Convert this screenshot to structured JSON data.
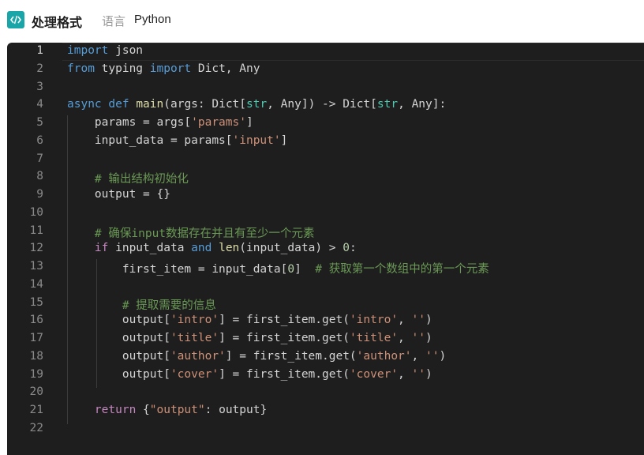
{
  "header": {
    "icon": "code-icon",
    "title": "处理格式",
    "language_label": "语言",
    "language_value": "Python"
  },
  "editor": {
    "current_line": 1,
    "lines": [
      {
        "n": "1",
        "tokens": [
          [
            "kw",
            "import"
          ],
          [
            "p",
            " json"
          ]
        ]
      },
      {
        "n": "2",
        "tokens": [
          [
            "kw",
            "from"
          ],
          [
            "p",
            " typing "
          ],
          [
            "kw",
            "import"
          ],
          [
            "p",
            " Dict, Any"
          ]
        ]
      },
      {
        "n": "3",
        "tokens": []
      },
      {
        "n": "4",
        "tokens": [
          [
            "kw",
            "async"
          ],
          [
            "p",
            " "
          ],
          [
            "kw",
            "def"
          ],
          [
            "p",
            " "
          ],
          [
            "fn",
            "main"
          ],
          [
            "p",
            "("
          ],
          [
            "p",
            "args"
          ],
          [
            "p",
            ": Dict["
          ],
          [
            "ty",
            "str"
          ],
          [
            "p",
            ", Any]) -> Dict["
          ],
          [
            "ty",
            "str"
          ],
          [
            "p",
            ", Any]:"
          ]
        ]
      },
      {
        "n": "5",
        "tokens": [
          [
            "p",
            "    params = args["
          ],
          [
            "str",
            "'params'"
          ],
          [
            "p",
            "]"
          ]
        ]
      },
      {
        "n": "6",
        "tokens": [
          [
            "p",
            "    input_data = params["
          ],
          [
            "str",
            "'input'"
          ],
          [
            "p",
            "]"
          ]
        ]
      },
      {
        "n": "7",
        "tokens": []
      },
      {
        "n": "8",
        "tokens": [
          [
            "p",
            "    "
          ],
          [
            "cmt",
            "# 输出结构初始化"
          ]
        ]
      },
      {
        "n": "9",
        "tokens": [
          [
            "p",
            "    output = {}"
          ]
        ]
      },
      {
        "n": "10",
        "tokens": []
      },
      {
        "n": "11",
        "tokens": [
          [
            "p",
            "    "
          ],
          [
            "cmt",
            "# 确保input数据存在并且有至少一个元素"
          ]
        ]
      },
      {
        "n": "12",
        "tokens": [
          [
            "p",
            "    "
          ],
          [
            "kwc",
            "if"
          ],
          [
            "p",
            " input_data "
          ],
          [
            "kw",
            "and"
          ],
          [
            "p",
            " "
          ],
          [
            "fn",
            "len"
          ],
          [
            "p",
            "(input_data) > "
          ],
          [
            "num",
            "0"
          ],
          [
            "p",
            ":"
          ]
        ]
      },
      {
        "n": "13",
        "tokens": [
          [
            "p",
            "        first_item = input_data["
          ],
          [
            "num",
            "0"
          ],
          [
            "p",
            "]  "
          ],
          [
            "cmt",
            "# 获取第一个数组中的第一个元素"
          ]
        ]
      },
      {
        "n": "14",
        "tokens": []
      },
      {
        "n": "15",
        "tokens": [
          [
            "p",
            "        "
          ],
          [
            "cmt",
            "# 提取需要的信息"
          ]
        ]
      },
      {
        "n": "16",
        "tokens": [
          [
            "p",
            "        output["
          ],
          [
            "str",
            "'intro'"
          ],
          [
            "p",
            "] = first_item.get("
          ],
          [
            "str",
            "'intro'"
          ],
          [
            "p",
            ", "
          ],
          [
            "str",
            "''"
          ],
          [
            "p",
            ")"
          ]
        ]
      },
      {
        "n": "17",
        "tokens": [
          [
            "p",
            "        output["
          ],
          [
            "str",
            "'title'"
          ],
          [
            "p",
            "] = first_item.get("
          ],
          [
            "str",
            "'title'"
          ],
          [
            "p",
            ", "
          ],
          [
            "str",
            "''"
          ],
          [
            "p",
            ")"
          ]
        ]
      },
      {
        "n": "18",
        "tokens": [
          [
            "p",
            "        output["
          ],
          [
            "str",
            "'author'"
          ],
          [
            "p",
            "] = first_item.get("
          ],
          [
            "str",
            "'author'"
          ],
          [
            "p",
            ", "
          ],
          [
            "str",
            "''"
          ],
          [
            "p",
            ")"
          ]
        ]
      },
      {
        "n": "19",
        "tokens": [
          [
            "p",
            "        output["
          ],
          [
            "str",
            "'cover'"
          ],
          [
            "p",
            "] = first_item.get("
          ],
          [
            "str",
            "'cover'"
          ],
          [
            "p",
            ", "
          ],
          [
            "str",
            "''"
          ],
          [
            "p",
            ")"
          ]
        ]
      },
      {
        "n": "20",
        "tokens": []
      },
      {
        "n": "21",
        "tokens": [
          [
            "p",
            "    "
          ],
          [
            "kwc",
            "return"
          ],
          [
            "p",
            " {"
          ],
          [
            "str",
            "\"output\""
          ],
          [
            "p",
            ": output}"
          ]
        ]
      },
      {
        "n": "22",
        "tokens": []
      }
    ]
  },
  "colors": {
    "editor_bg": "#1e1e1e",
    "keyword": "#569cd6",
    "control_keyword": "#c586c0",
    "string": "#ce9178",
    "function": "#dcdcaa",
    "type": "#4ec9b0",
    "number": "#b5cea8",
    "comment": "#6a9955",
    "icon_bg": "#1aa5a8"
  }
}
